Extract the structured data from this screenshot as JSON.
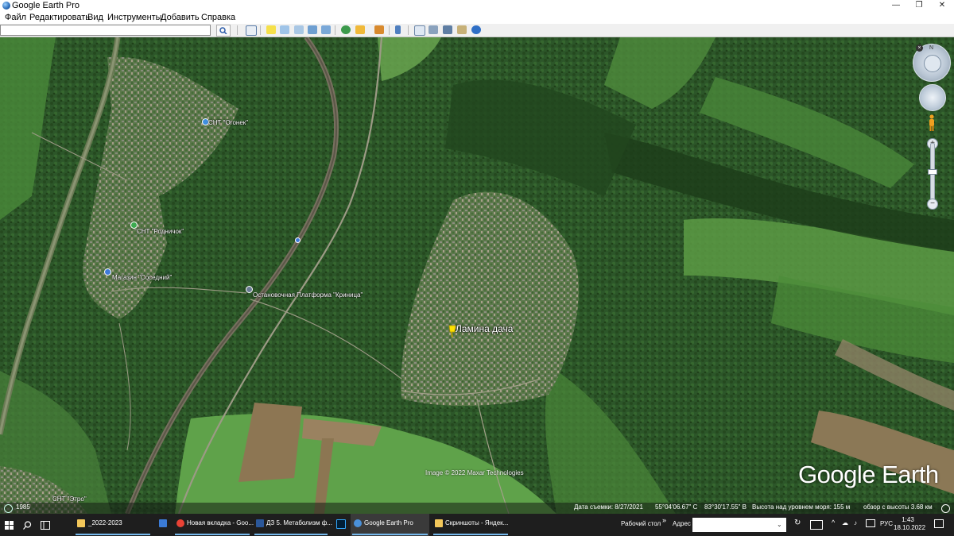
{
  "window": {
    "title": "Google Earth Pro",
    "controls": [
      "—",
      "❐",
      "✕"
    ]
  },
  "menu": {
    "items": [
      "Файл",
      "Редактировать",
      "Вид",
      "Инструменты",
      "Добавить",
      "Справка"
    ]
  },
  "toolbar": {
    "search_value": "",
    "icons": [
      "sidebar-icon",
      "placemark-icon",
      "polygon-icon",
      "path-icon",
      "image-overlay-icon",
      "record-tour-icon",
      "historical-imagery-icon",
      "sun-icon",
      "planets-icon",
      "ruler-icon",
      "email-icon",
      "print-icon",
      "save-image-icon",
      "view-in-maps-icon",
      "earth-icon"
    ]
  },
  "map": {
    "labels": {
      "ogonek": "СНТ \"Огонек\"",
      "rodnichok": "СНТ \"Родничок\"",
      "shop": "Магазин \"Соседний\"",
      "platform": "Остановочная Платформа \"Криница\"",
      "etro": "СНТ \"Этро\""
    },
    "placemark_label": "Ламина дача",
    "watermark": "Google Earth",
    "imagery_credit": "Image © 2022 Maxar Technologies",
    "nav_north": "N"
  },
  "status": {
    "history_year": "1985",
    "date": "Дата съемки: 8/27/2021",
    "lat": "55°04'06.67\" С",
    "lon": "83°30'17.55\" В",
    "elevation": "Высота над уровнем моря:  155 м",
    "eye_alt": "обзор с высоты   3.68 км"
  },
  "taskbar": {
    "items": [
      {
        "label": "_2022-2023",
        "color": "#f3c75a"
      },
      {
        "label": "",
        "color": "#3b7bd6"
      },
      {
        "label": "Новая вкладка - Goo...",
        "color": "#e94235"
      },
      {
        "label": "ДЗ 5. Метаболизм ф...",
        "color": "#2b579a"
      },
      {
        "label": "",
        "color": "#31a8ff"
      },
      {
        "label": "Google Earth Pro",
        "color": "#4a90d9"
      },
      {
        "label": "Скриншоты - Яндек...",
        "color": "#f3c75a"
      }
    ],
    "desktop": "Рабочий стол",
    "address_label": "Адрес",
    "address_value": "",
    "language": "РУС",
    "time": "1:43",
    "date": "18.10.2022"
  },
  "colors": {
    "forest": "#2f5a2c",
    "field": "#5e9a45",
    "accent": "#76b9ed",
    "placemark": "#ffe100"
  }
}
